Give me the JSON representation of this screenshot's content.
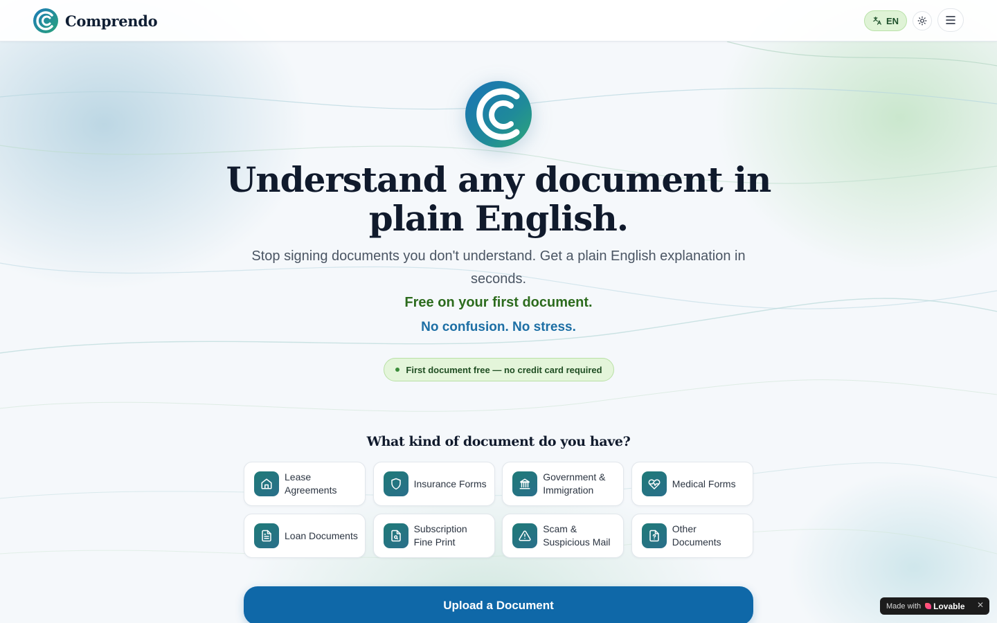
{
  "app": {
    "brand_name": "Comprendo",
    "language_code": "EN"
  },
  "icons": {
    "translate": "translate-icon",
    "theme": "sun-icon",
    "menu": "hamburger-menu-icon"
  },
  "hero": {
    "headline": "Understand any document in plain English.",
    "subtitle": "Stop signing documents you don't understand. Get a plain English explanation in seconds.",
    "free_line": "Free on your first document.",
    "calm_line": "No confusion. No stress.",
    "pill": "First document free — no credit card required"
  },
  "documents": {
    "title": "What kind of document do you have?",
    "items": [
      {
        "label": "Lease Agreements",
        "icon": "home-icon"
      },
      {
        "label": "Insurance Forms",
        "icon": "shield-icon"
      },
      {
        "label": "Government & Immigration",
        "icon": "landmark-icon"
      },
      {
        "label": "Medical Forms",
        "icon": "heart-pulse-icon"
      },
      {
        "label": "Loan Documents",
        "icon": "file-text-icon"
      },
      {
        "label": "Subscription Fine Print",
        "icon": "file-search-icon"
      },
      {
        "label": "Scam & Suspicious Mail",
        "icon": "warning-triangle-icon"
      },
      {
        "label": "Other Documents",
        "icon": "file-question-icon"
      }
    ]
  },
  "cta": {
    "upload_label": "Upload a Document"
  },
  "badge": {
    "made_with": "Made with",
    "brand": "Lovable",
    "close": "✕"
  },
  "colors": {
    "primary": "#0f68a8",
    "accent_green": "#2c6b1d",
    "icon_teal": "#1f7a78"
  }
}
